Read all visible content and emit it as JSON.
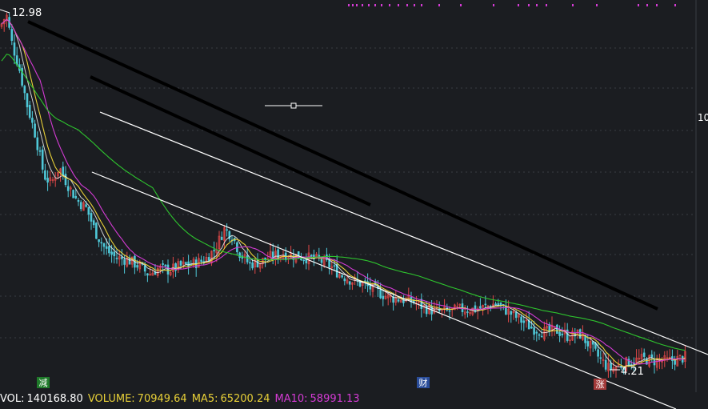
{
  "chart_data": {
    "type": "candlestick",
    "price_high_label": "12.98",
    "price_low_label": "4.21",
    "right_edge_label": "10",
    "event_markers": [
      {
        "label": "减",
        "color": "#1f7a2a"
      },
      {
        "label": "财",
        "color": "#2a4d9a"
      },
      {
        "label": "涨",
        "color": "#a33a3a"
      }
    ],
    "indicators": {
      "vol_label": "VOL:",
      "vol_value": "140168.80",
      "volume_label": "VOLUME:",
      "volume_value": "70949.64",
      "ma5_label": "MA5:",
      "ma5_value": "65200.24",
      "ma10_label": "MA10:",
      "ma10_value": "58991.13"
    },
    "colors": {
      "background": "#1b1d21",
      "up": "#e04848",
      "down": "#4fc8d8",
      "ma_short": "#e8d038",
      "ma_mid": "#d43bd4",
      "ma_long": "#2ec42e",
      "channel": "#ffffff",
      "trendline": "#000000",
      "vol_text": "#ffffff",
      "volume_text": "#e8d038",
      "ma5_text": "#e8d038",
      "ma10_text": "#d43bd4"
    },
    "price_path": [
      [
        0,
        12.6
      ],
      [
        8,
        12.9
      ],
      [
        15,
        12.2
      ],
      [
        24,
        11.6
      ],
      [
        34,
        10.7
      ],
      [
        44,
        10.0
      ],
      [
        55,
        9.0
      ],
      [
        64,
        8.8
      ],
      [
        74,
        9.2
      ],
      [
        84,
        8.8
      ],
      [
        96,
        8.4
      ],
      [
        108,
        8.2
      ],
      [
        120,
        7.6
      ],
      [
        132,
        7.2
      ],
      [
        145,
        7.0
      ],
      [
        160,
        6.95
      ],
      [
        174,
        6.8
      ],
      [
        186,
        6.6
      ],
      [
        198,
        6.75
      ],
      [
        212,
        6.7
      ],
      [
        225,
        6.8
      ],
      [
        240,
        6.85
      ],
      [
        256,
        6.95
      ],
      [
        270,
        7.25
      ],
      [
        280,
        7.7
      ],
      [
        290,
        7.55
      ],
      [
        300,
        7.1
      ],
      [
        312,
        6.85
      ],
      [
        325,
        6.9
      ],
      [
        340,
        7.05
      ],
      [
        355,
        7.1
      ],
      [
        370,
        7.05
      ],
      [
        385,
        7.0
      ],
      [
        398,
        6.95
      ],
      [
        410,
        6.85
      ],
      [
        425,
        6.6
      ],
      [
        440,
        6.45
      ],
      [
        455,
        6.35
      ],
      [
        470,
        6.2
      ],
      [
        485,
        6.05
      ],
      [
        500,
        6.0
      ],
      [
        515,
        5.95
      ],
      [
        530,
        5.8
      ],
      [
        545,
        5.7
      ],
      [
        560,
        5.7
      ],
      [
        575,
        5.75
      ],
      [
        590,
        5.75
      ],
      [
        605,
        5.8
      ],
      [
        620,
        5.9
      ],
      [
        635,
        5.7
      ],
      [
        650,
        5.5
      ],
      [
        665,
        5.3
      ],
      [
        680,
        5.2
      ],
      [
        695,
        5.25
      ],
      [
        710,
        5.1
      ],
      [
        725,
        5.15
      ],
      [
        738,
        4.85
      ],
      [
        750,
        4.55
      ],
      [
        762,
        4.3
      ],
      [
        775,
        4.4
      ],
      [
        790,
        4.5
      ],
      [
        805,
        4.55
      ],
      [
        820,
        4.5
      ],
      [
        835,
        4.5
      ],
      [
        848,
        4.55
      ],
      [
        857,
        4.6
      ]
    ]
  }
}
